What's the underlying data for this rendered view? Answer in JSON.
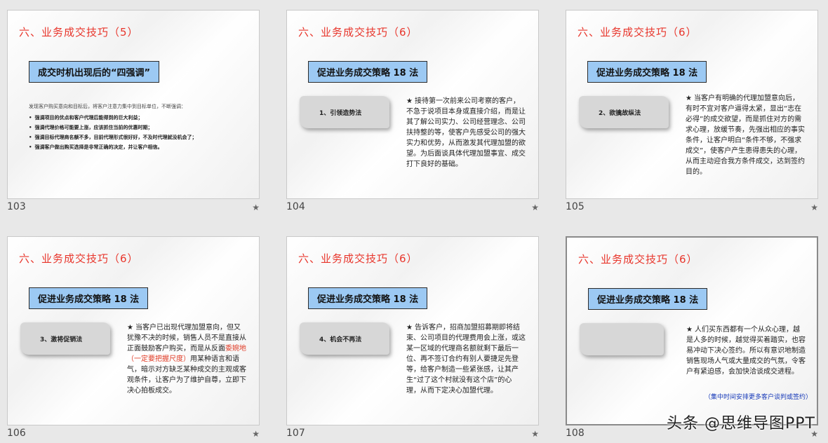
{
  "slides": [
    {
      "number": "103",
      "title": "六、业务成交技巧（5）",
      "banner": "成交时机出现后的“四强调”",
      "lead": "发现客户购买意向和目标后，将客户注意力集中到目标单位，不断强调：",
      "bullet": "•",
      "points": [
        "强调项目的优点和客户代理后能得到的巨大利益；",
        "强调代理价格可能要上涨，应该抓住当前的优惠时期；",
        "强调目标代理商名额不多，目前代理形式很好好，不及时代理就没机会了；",
        "强调客户做出购买选择是非常正确的决定，并让客户相信。"
      ]
    },
    {
      "number": "104",
      "title": "六、业务成交技巧（6）",
      "banner": "促进业务成交策略 18 法",
      "label": "1、引领造势法",
      "star": "★",
      "text": "接待第一次前来公司考察的客户，不急于说项目本身或直接介绍，而是让其了解公司实力、公司经营理念、公司扶持整的等，使客户先感受公司的强大实力和优势，从而激发其代理加盟的欲望。为后面谈具体代理加盟事宜、成交打下良好的基础。"
    },
    {
      "number": "105",
      "title": "六、业务成交技巧（6）",
      "banner": "促进业务成交策略 18 法",
      "label": "2、欲擒故纵法",
      "star": "★",
      "text": "当客户有明确的代理加盟意向后，有时不宜对客户逼得太紧，显出“志在必得”的成交欲望，而是抓住对方的需求心理，放缓节奏，先强出相应的事实条件，让客户明白“条件不够，不强求成交”，使客户产生患得患失的心理，从而主动迎合我方条件成交，达到签约目的。"
    },
    {
      "number": "106",
      "title": "六、业务成交技巧（6）",
      "banner": "促进业务成交策略 18 法",
      "label": "3、激将促销法",
      "star": "★",
      "text_a": "当客户已出现代理加盟意向，但又犹豫不决的时候，销售人员不是直接从正面鼓励客户购买，而是从反面",
      "text_red": "委婉地（一定要把握尺度）",
      "text_b": "用某种语言和语气，暗示对方缺乏某种成交的主观或客观条件，让客户为了维护自尊，立即下决心拍板成交。"
    },
    {
      "number": "107",
      "title": "六、业务成交技巧（6）",
      "banner": "促进业务成交策略 18 法",
      "label": "4、机会不再法",
      "star": "★",
      "text": "告诉客户，招商加盟招募期即将结束、公司项目的代理费用会上涨，或这某一区域的代理商名额就剩下最后一位、再不签订合约有别人要捷足先登等，给客户制造一些紧张感，让其产生“过了这个村就没有这个店”的心理，从而下定决心加盟代理。"
    },
    {
      "number": "108",
      "title": "六、业务成交技巧（6）",
      "banner": "促进业务成交策略 18 法",
      "star": "★",
      "text": "人们买东西都有一个从众心理，越是人多的时候，越觉得买着踏实，也容易冲动下决心签约。所以有意识地制造销售现场人气或大量成交的气氛，令客户有紧迫感，会加快洽谈成交进程。",
      "note": "（集中时间安排更多客户谈判或签约）"
    }
  ],
  "slot_star": "★",
  "watermark": "头条 @思维导图PPT"
}
